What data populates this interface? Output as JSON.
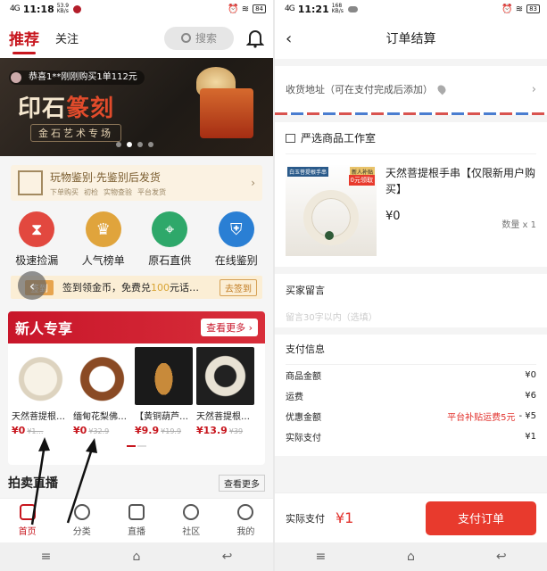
{
  "left": {
    "status": {
      "signal": "4G",
      "time": "11:18",
      "speed_top": "53.9",
      "speed_bottom": "KB/s",
      "battery": "84"
    },
    "header": {
      "tab_recommend": "推荐",
      "tab_follow": "关注",
      "search_placeholder": "搜索"
    },
    "banner": {
      "notice": "恭喜1**刚刚购买1单112元",
      "title_left": "印石",
      "title_right": "篆刻",
      "subtitle": "金石艺术专场"
    },
    "authentic": {
      "title": "玩物鉴别·先鉴别后发货",
      "steps": [
        "下单购买",
        "初检",
        "实物查验",
        "平台发货"
      ]
    },
    "categories": [
      {
        "label": "极速捡漏",
        "icon": "hourglass-icon",
        "color": "#e2483f"
      },
      {
        "label": "人气榜单",
        "icon": "crown-icon",
        "color": "#e0a43c"
      },
      {
        "label": "原石直供",
        "icon": "map-pin-icon",
        "color": "#2ea86a"
      },
      {
        "label": "在线鉴别",
        "icon": "shield-icon",
        "color": "#2a7fd4"
      }
    ],
    "signin": {
      "tag": "签到",
      "text_pre": "签到领金币，免费兑",
      "text_hl": "100",
      "text_post": "元话…",
      "button": "去签到"
    },
    "new_user": {
      "title": "新人专享",
      "more": "查看更多",
      "products": [
        {
          "name": "天然菩提根…",
          "price": "¥0",
          "old": "¥1…"
        },
        {
          "name": "缅甸花梨佛…",
          "price": "¥0",
          "old": "¥32.9"
        },
        {
          "name": "【黄铜葫芦…",
          "price": "¥9.9",
          "old": "¥19.9"
        },
        {
          "name": "天然菩提根…",
          "price": "¥13.9",
          "old": "¥39"
        }
      ]
    },
    "live": {
      "title": "拍卖直播",
      "more": "查看更多"
    },
    "bottom_nav": [
      "首页",
      "分类",
      "直播",
      "社区",
      "我的"
    ]
  },
  "right": {
    "status": {
      "signal": "4G",
      "time": "11:21",
      "speed_top": "168",
      "speed_bottom": "KB/s",
      "battery": "83"
    },
    "header": {
      "title": "订单结算"
    },
    "address": {
      "label": "收货地址（可在支付完成后添加）"
    },
    "store": {
      "name": "严选商品工作室",
      "item": {
        "name": "天然菩提根手串【仅限新用户购买】",
        "price": "¥0",
        "qty": "数量 x 1",
        "badge_left": "白玉菩提根手串",
        "badge_right": "新人补贴",
        "badge_tag": "0元领取"
      }
    },
    "message": {
      "label": "买家留言",
      "placeholder": "留言30字以内（选填）"
    },
    "payment": {
      "title": "支付信息",
      "rows": [
        {
          "label": "商品金额",
          "hint": "",
          "value": "¥0"
        },
        {
          "label": "运费",
          "hint": "",
          "value": "¥6"
        },
        {
          "label": "优惠金额",
          "hint": "平台补贴运费5元",
          "value": "- ¥5"
        },
        {
          "label": "实际支付",
          "hint": "",
          "value": "¥1"
        }
      ]
    },
    "footer": {
      "label": "实际支付",
      "amount": "¥1",
      "button": "支付订单"
    }
  }
}
